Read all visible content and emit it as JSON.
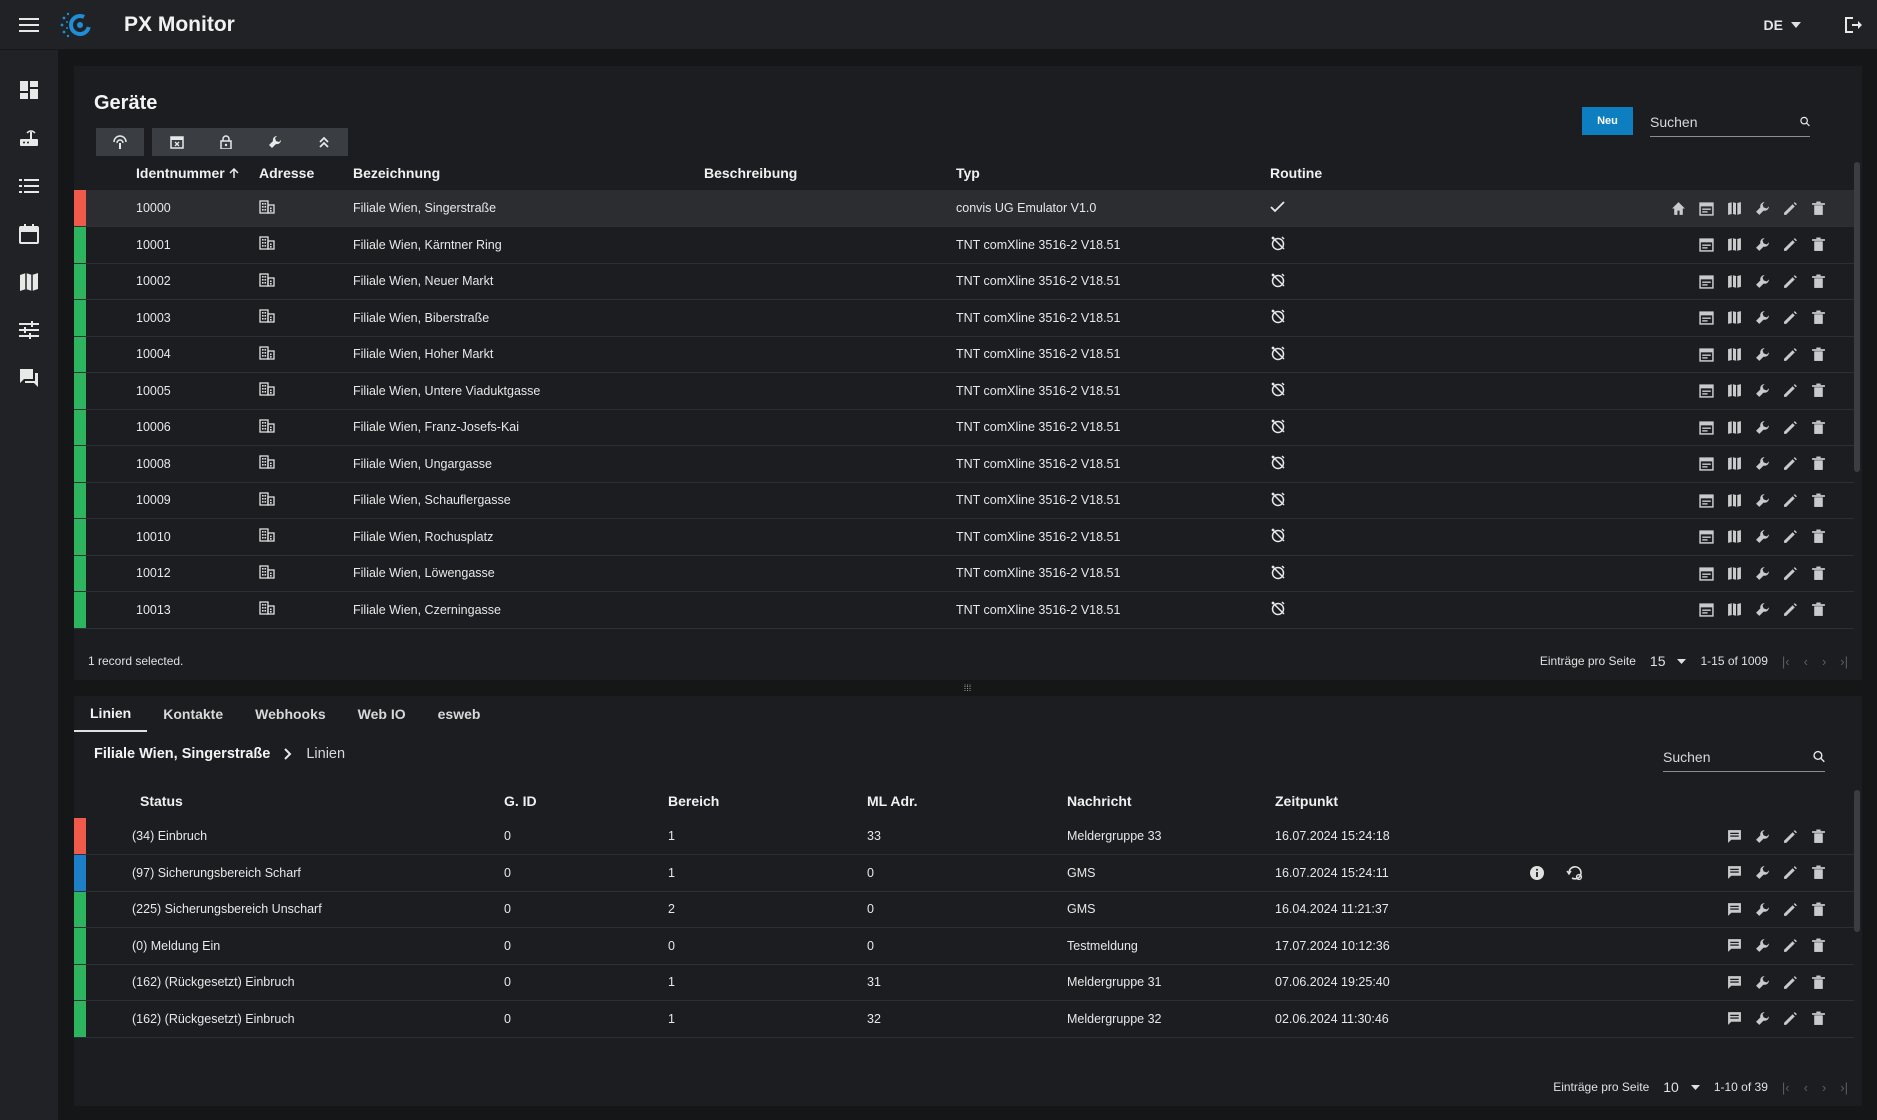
{
  "app": {
    "title": "PX Monitor",
    "language": "DE"
  },
  "nav": [
    "dashboard-icon",
    "router-icon",
    "list-icon",
    "calendar-icon",
    "map-icon",
    "tune-icon",
    "chat-icon"
  ],
  "devices": {
    "title": "Geräte",
    "new_label": "Neu",
    "search_placeholder": "Suchen",
    "columns": {
      "id": "Identnummer",
      "address": "Adresse",
      "name": "Bezeichnung",
      "desc": "Beschreibung",
      "type": "Typ",
      "routine": "Routine"
    },
    "rows": [
      {
        "status": "#f05a4a",
        "id": "10000",
        "name": "Filiale Wien, Singerstraße",
        "desc": "",
        "type": "convis UG Emulator V1.0",
        "routine": "check",
        "home": true
      },
      {
        "status": "#2db45e",
        "id": "10001",
        "name": "Filiale Wien, Kärntner Ring",
        "desc": "",
        "type": "TNT comXline 3516-2 V18.51",
        "routine": "alarm-off"
      },
      {
        "status": "#2db45e",
        "id": "10002",
        "name": "Filiale Wien, Neuer Markt",
        "desc": "",
        "type": "TNT comXline 3516-2 V18.51",
        "routine": "alarm-off"
      },
      {
        "status": "#2db45e",
        "id": "10003",
        "name": "Filiale Wien, Biberstraße",
        "desc": "",
        "type": "TNT comXline 3516-2 V18.51",
        "routine": "alarm-off"
      },
      {
        "status": "#2db45e",
        "id": "10004",
        "name": "Filiale Wien, Hoher Markt",
        "desc": "",
        "type": "TNT comXline 3516-2 V18.51",
        "routine": "alarm-off"
      },
      {
        "status": "#2db45e",
        "id": "10005",
        "name": "Filiale Wien, Untere Viaduktgasse",
        "desc": "",
        "type": "TNT comXline 3516-2 V18.51",
        "routine": "alarm-off"
      },
      {
        "status": "#2db45e",
        "id": "10006",
        "name": "Filiale Wien, Franz-Josefs-Kai",
        "desc": "",
        "type": "TNT comXline 3516-2 V18.51",
        "routine": "alarm-off"
      },
      {
        "status": "#2db45e",
        "id": "10008",
        "name": "Filiale Wien, Ungargasse",
        "desc": "",
        "type": "TNT comXline 3516-2 V18.51",
        "routine": "alarm-off"
      },
      {
        "status": "#2db45e",
        "id": "10009",
        "name": "Filiale Wien, Schauflergasse",
        "desc": "",
        "type": "TNT comXline 3516-2 V18.51",
        "routine": "alarm-off"
      },
      {
        "status": "#2db45e",
        "id": "10010",
        "name": "Filiale Wien, Rochusplatz",
        "desc": "",
        "type": "TNT comXline 3516-2 V18.51",
        "routine": "alarm-off"
      },
      {
        "status": "#2db45e",
        "id": "10012",
        "name": "Filiale Wien, Löwengasse",
        "desc": "",
        "type": "TNT comXline 3516-2 V18.51",
        "routine": "alarm-off"
      },
      {
        "status": "#2db45e",
        "id": "10013",
        "name": "Filiale Wien, Czerningasse",
        "desc": "",
        "type": "TNT comXline 3516-2 V18.51",
        "routine": "alarm-off"
      }
    ],
    "selection_text": "1 record selected.",
    "per_page_label": "Einträge pro Seite",
    "per_page": "15",
    "range": "1-15 of 1009"
  },
  "lines": {
    "tabs": [
      "Linien",
      "Kontakte",
      "Webhooks",
      "Web IO",
      "esweb"
    ],
    "active_tab": 0,
    "crumb": {
      "device": "Filiale Wien, Singerstraße",
      "section": "Linien"
    },
    "search_placeholder": "Suchen",
    "columns": {
      "status": "Status",
      "gid": "G. ID",
      "area": "Bereich",
      "ml": "ML Adr.",
      "msg": "Nachricht",
      "time": "Zeitpunkt"
    },
    "rows": [
      {
        "color": "#f05a4a",
        "status": "(34) Einbruch",
        "gid": "0",
        "area": "1",
        "ml": "33",
        "msg": "Meldergruppe 33",
        "time": "16.07.2024 15:24:18",
        "extra": false
      },
      {
        "color": "#1c7fc8",
        "status": "(97) Sicherungsbereich Scharf",
        "gid": "0",
        "area": "1",
        "ml": "0",
        "msg": "GMS",
        "time": "16.07.2024 15:24:11",
        "extra": true
      },
      {
        "color": "#2db45e",
        "status": "(225) Sicherungsbereich Unscharf",
        "gid": "0",
        "area": "2",
        "ml": "0",
        "msg": "GMS",
        "time": "16.04.2024 11:21:37",
        "extra": false
      },
      {
        "color": "#2db45e",
        "status": "(0) Meldung Ein",
        "gid": "0",
        "area": "0",
        "ml": "0",
        "msg": "Testmeldung",
        "time": "17.07.2024 10:12:36",
        "extra": false
      },
      {
        "color": "#2db45e",
        "status": "(162) (Rückgesetzt) Einbruch",
        "gid": "0",
        "area": "1",
        "ml": "31",
        "msg": "Meldergruppe 31",
        "time": "07.06.2024 19:25:40",
        "extra": false
      },
      {
        "color": "#2db45e",
        "status": "(162) (Rückgesetzt) Einbruch",
        "gid": "0",
        "area": "1",
        "ml": "32",
        "msg": "Meldergruppe 32",
        "time": "02.06.2024 11:30:46",
        "extra": false
      }
    ],
    "per_page_label": "Einträge pro Seite",
    "per_page": "10",
    "range": "1-10 of 39"
  }
}
